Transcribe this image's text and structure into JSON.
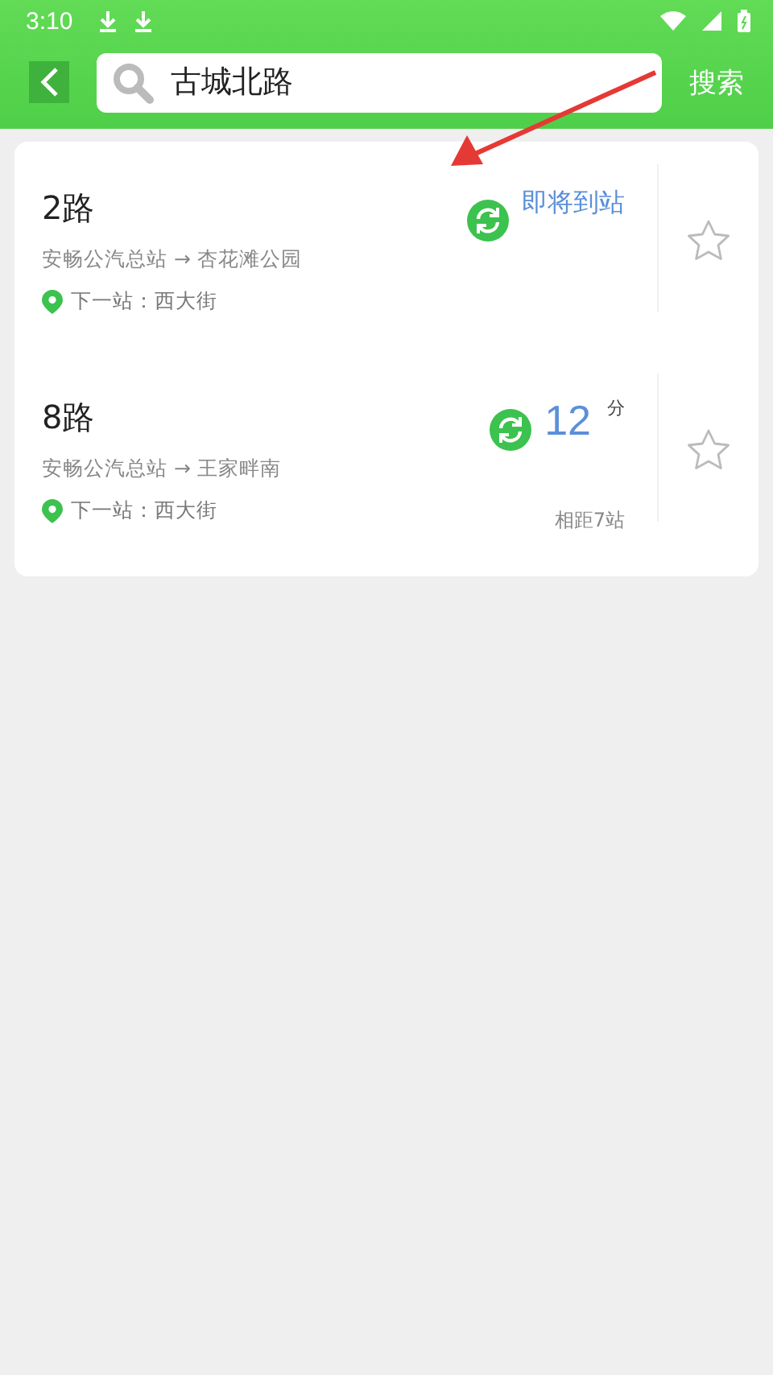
{
  "status_bar": {
    "time": "3:10"
  },
  "header": {
    "search": {
      "value": "古城北路"
    },
    "search_button": "搜索"
  },
  "routes": [
    {
      "name": "2路",
      "direction": "安畅公汽总站 → 杏花滩公园",
      "next_stop": "下一站：西大街",
      "arrival": {
        "kind": "arriving",
        "text": "即将到站"
      },
      "starred": false
    },
    {
      "name": "8路",
      "direction": "安畅公汽总站 → 王家畔南",
      "next_stop": "下一站：西大街",
      "arrival": {
        "kind": "minutes",
        "value": "12",
        "unit": "分"
      },
      "distance": "相距7站",
      "starred": false
    }
  ]
}
